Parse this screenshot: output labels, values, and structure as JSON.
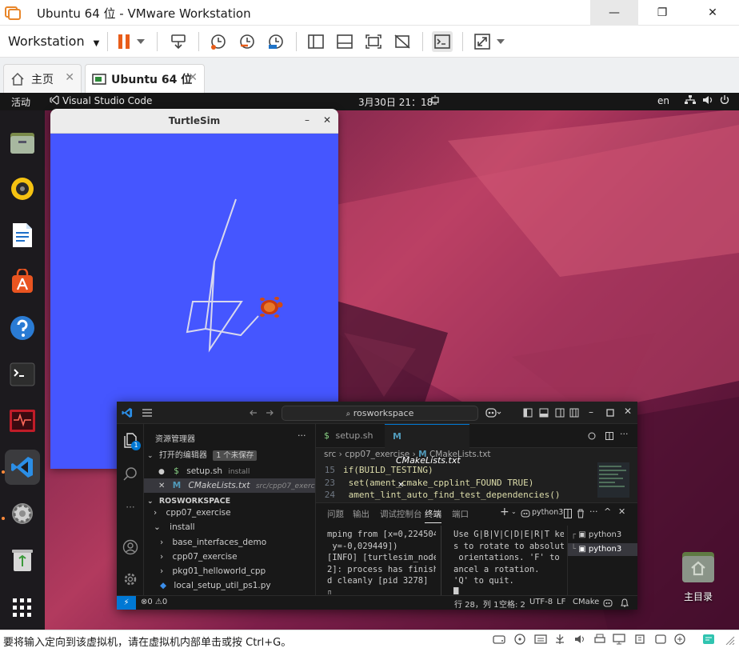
{
  "window": {
    "title": "Ubuntu 64 位 - VMware Workstation",
    "minimize": "—",
    "maximize": "❐",
    "close": "✕"
  },
  "toolbar": {
    "menu_label": "Workstation",
    "menu_caret": "▼"
  },
  "tabs": [
    {
      "label": "主页",
      "close": "✕"
    },
    {
      "label": "Ubuntu 64 位",
      "close": "✕"
    }
  ],
  "gnome": {
    "activities": "活动",
    "focused_app": "Visual Studio Code",
    "clock": "3月30日 21：18",
    "language": "en"
  },
  "turtlesim": {
    "title": "TurtleSim",
    "minimize": "–",
    "close": "✕"
  },
  "desktop": {
    "home_label": "主目录"
  },
  "vscode": {
    "search": "rosworkspace",
    "sidebar_title": "资源管理器",
    "sidebar_more": "···",
    "open_editors": "打开的编辑器",
    "unsaved_badge": "1 个未保存",
    "activity_badge": "1",
    "open_files": [
      {
        "marker": "●",
        "lang": "$",
        "name": "setup.sh",
        "hint": "install"
      },
      {
        "marker": "✕",
        "lang": "M",
        "name": "CMakeLists.txt",
        "hint": "src/cpp07_exercise"
      }
    ],
    "workspace": "ROSWORKSPACE",
    "tree": [
      {
        "chevron": "›",
        "label": "cpp07_exercise"
      },
      {
        "chevron": "⌄",
        "label": "install"
      },
      {
        "chevron": "›",
        "label": "base_interfaces_demo"
      },
      {
        "chevron": "›",
        "label": "cpp07_exercise"
      },
      {
        "chevron": "›",
        "label": "pkg01_helloworld_cpp"
      },
      {
        "chevron": "",
        "label": "local_setup_util_ps1.py"
      }
    ],
    "editor_tabs": [
      {
        "icon": "$",
        "label": "setup.sh"
      },
      {
        "icon": "M",
        "label": "CMakeLists.txt",
        "close": "✕"
      }
    ],
    "breadcrumb": [
      "src",
      "cpp07_exercise",
      "M",
      "CMakeLists.txt"
    ],
    "code": [
      {
        "line": "15",
        "text": "if(BUILD_TESTING)"
      },
      {
        "line": "23",
        "text": "  set(ament_cmake_cpplint_FOUND TRUE)"
      },
      {
        "line": "24",
        "text": "  ament_lint_auto_find_test_dependencies()"
      }
    ],
    "panel_tabs": [
      "问题",
      "输出",
      "调试控制台",
      "终端",
      "端口"
    ],
    "panel_active": "终端",
    "terminal_name": "python3",
    "terminal_left": "mping from [x=0,224504,\n y=-0,029449])\n[INFO] [turtlesim_node-\n2]: process has finishe\nd cleanly [pid 3278]\n▯",
    "terminal_right": "Use G|B|V|C|D|E|R|T key\ns to rotate to absolute\n orientations. 'F' to c\nancel a rotation.\n'Q' to quit.\n█",
    "terminal_list": [
      "python3",
      "python3"
    ],
    "status": {
      "remote": "⚡",
      "problems": "⊗0 ⚠0",
      "position": "行 28，列 1",
      "spaces": "空格: 2",
      "encoding": "UTF-8",
      "eol": "LF",
      "language": "CMake"
    }
  },
  "statusbar": {
    "message": "要将输入定向到该虚拟机，请在虚拟机内部单击或按 Ctrl+G。"
  },
  "colors": {
    "turtlesim_bg": "#4556ff",
    "vscode_accent": "#0078d4",
    "ubuntu_orange": "#e95420"
  }
}
